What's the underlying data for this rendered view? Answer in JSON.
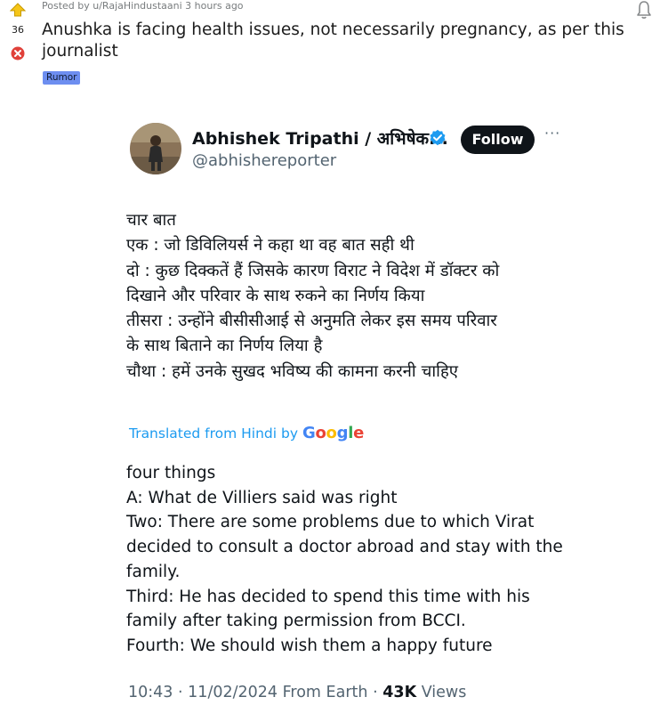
{
  "post": {
    "score": "36",
    "posted_by": "Posted by u/RajaHindustaani 3 hours ago",
    "title": "Anushka is facing health issues, not necessarily pregnancy, as per this journalist",
    "flair": "Rumor"
  },
  "tweet": {
    "author_name": "Abhishek Tripathi / अभिषेक...",
    "handle": "@abhishereporter",
    "follow_label": "Follow",
    "more_label": "···",
    "hindi_lines": [
      "चार बात",
      "एक : जो डिविलियर्स ने कहा था वह बात सही थी",
      "दो : कुछ दिक्कतें हैं जिसके कारण विराट ने विदेश में डॉक्टर को",
      "दिखाने और परिवार के साथ रुकने का निर्णय किया",
      "तीसरा : उन्होंने बीसीसीआई से अनुमति लेकर इस समय परिवार",
      "के साथ बिताने का निर्णय लिया है",
      "चौथा : हमें उनके सुखद भविष्य की कामना करनी चाहिए"
    ],
    "translated_label": "Translated from Hindi by",
    "google_label": "Google",
    "english_lines": [
      "four things",
      "A: What de Villiers said was right",
      "Two: There are some problems due to which Virat",
      "decided to consult a doctor abroad and stay with the",
      "family.",
      "Third: He has decided to spend this time with his",
      "family after taking permission from BCCI.",
      "Fourth: We should wish them a happy future"
    ],
    "time": "10:43",
    "date": "11/02/2024",
    "source": "From Earth",
    "views_count": "43K",
    "views_label": "Views"
  },
  "colors": {
    "link_blue": "#1d9bf0",
    "verified_blue": "#1d9bf0",
    "flair_bg": "#6d8ef0",
    "upvote_yellow": "#f5c518",
    "downvote_red": "#e0413a"
  },
  "icons": [
    "upvote-icon",
    "downvote-icon",
    "report-icon",
    "verified-badge-icon",
    "more-options-icon"
  ]
}
